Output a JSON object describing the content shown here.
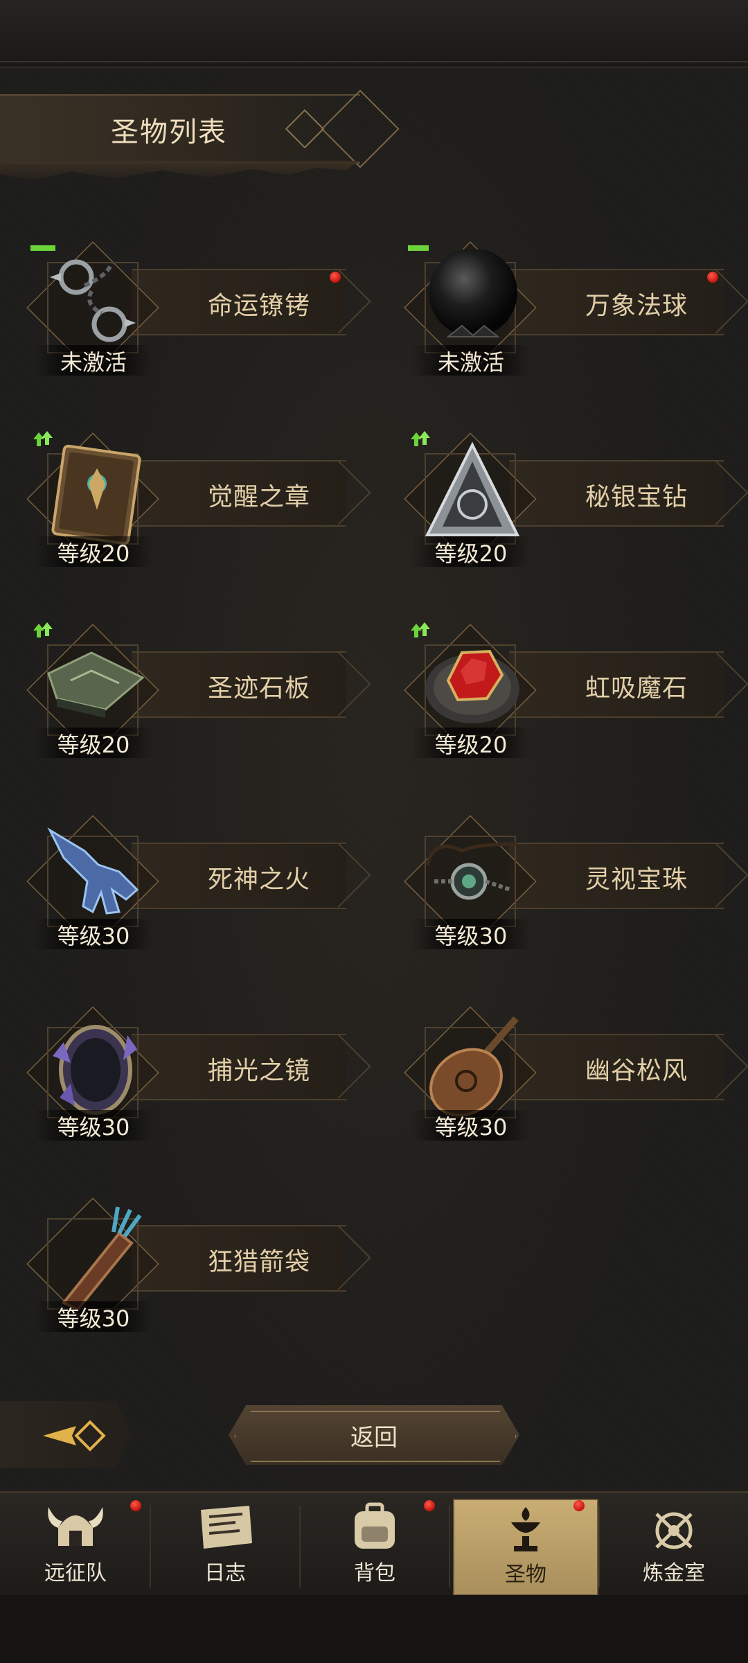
{
  "header": {
    "title": "圣物列表"
  },
  "relics": [
    {
      "name": "命运镣铐",
      "status": "未激活",
      "upgrade": true,
      "red_dot": true,
      "art_icon": "chain-shackles-icon"
    },
    {
      "name": "万象法球",
      "status": "未激活",
      "upgrade": true,
      "red_dot": true,
      "art_icon": "dark-orb-icon"
    },
    {
      "name": "觉醒之章",
      "status": "等级20",
      "upgrade": true,
      "red_dot": false,
      "art_icon": "ornate-book-icon"
    },
    {
      "name": "秘银宝钻",
      "status": "等级20",
      "upgrade": true,
      "red_dot": false,
      "art_icon": "silver-pyramid-icon"
    },
    {
      "name": "圣迹石板",
      "status": "等级20",
      "upgrade": true,
      "red_dot": false,
      "art_icon": "stone-tablet-icon"
    },
    {
      "name": "虹吸魔石",
      "status": "等级20",
      "upgrade": true,
      "red_dot": false,
      "art_icon": "red-gem-fur-icon"
    },
    {
      "name": "死神之火",
      "status": "等级30",
      "upgrade": false,
      "red_dot": false,
      "art_icon": "ghost-hand-icon"
    },
    {
      "name": "灵视宝珠",
      "status": "等级30",
      "upgrade": false,
      "red_dot": false,
      "art_icon": "amulet-necklace-icon"
    },
    {
      "name": "捕光之镜",
      "status": "等级30",
      "upgrade": false,
      "red_dot": false,
      "art_icon": "crystal-mirror-icon"
    },
    {
      "name": "幽谷松风",
      "status": "等级30",
      "upgrade": false,
      "red_dot": false,
      "art_icon": "lute-icon"
    },
    {
      "name": "狂猎箭袋",
      "status": "等级30",
      "upgrade": false,
      "red_dot": false,
      "art_icon": "arrow-quiver-icon"
    }
  ],
  "back_button": {
    "label": "返回"
  },
  "nav": [
    {
      "label": "远征队",
      "icon": "horned-helmet-icon",
      "red_dot": true,
      "active": false
    },
    {
      "label": "日志",
      "icon": "scroll-log-icon",
      "red_dot": false,
      "active": false
    },
    {
      "label": "背包",
      "icon": "backpack-icon",
      "red_dot": true,
      "active": false
    },
    {
      "label": "圣物",
      "icon": "chalice-relic-icon",
      "red_dot": true,
      "active": true
    },
    {
      "label": "炼金室",
      "icon": "alchemy-icon",
      "red_dot": false,
      "active": false
    }
  ],
  "colors": {
    "accent_gold": "#c9ad74",
    "red_dot": "#e0261c",
    "upgrade_green": "#6bd43a"
  }
}
